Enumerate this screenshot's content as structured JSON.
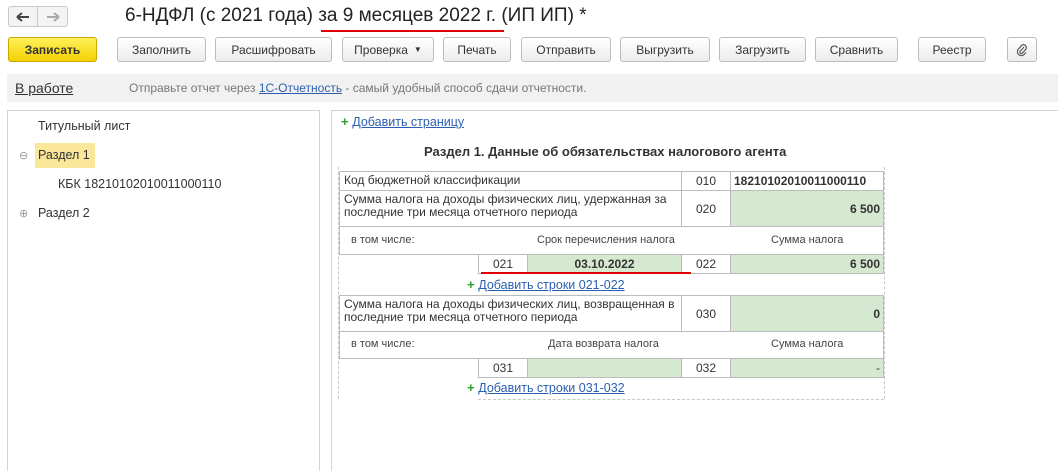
{
  "window": {
    "title_prefix": "6-НДФЛ (с 2021 года) ",
    "title_period": "за 9 месяцев 2022 г.",
    "title_suffix": " (ИП ИП) *",
    "back_icon": "arrow-left-icon",
    "forward_icon": "arrow-right-icon"
  },
  "toolbar": {
    "save": "Записать",
    "fill": "Заполнить",
    "decode": "Расшифровать",
    "check": "Проверка",
    "print": "Печать",
    "send": "Отправить",
    "export": "Выгрузить",
    "import": "Загрузить",
    "compare": "Сравнить",
    "registry": "Реестр",
    "attach_icon": "paperclip-icon"
  },
  "status": {
    "state": "В работе",
    "msg_before": "Отправьте отчет через ",
    "msg_link": "1С-Отчетность",
    "msg_after": " - самый удобный способ сдачи отчетности."
  },
  "tree": {
    "title_page": "Титульный лист",
    "section1": "Раздел 1",
    "kbk_item": "КБК 18210102010011000110",
    "section2": "Раздел 2"
  },
  "form": {
    "add_page": "Добавить страницу",
    "section_title": "Раздел 1. Данные об обязательствах налогового агента",
    "row010_label": "Код бюджетной классификации",
    "row010_code": "010",
    "row010_value": "18210102010011000110",
    "row020_label": "Сумма налога на доходы физических лиц, удержанная за последние три месяца отчетного периода",
    "row020_code": "020",
    "row020_value": "6 500",
    "including": "в том числе:",
    "transfer_deadline_header": "Срок перечисления налога",
    "tax_amount_header": "Сумма налога",
    "row021_code": "021",
    "row021_value": "03.10.2022",
    "row022_code": "022",
    "row022_value": "6 500",
    "add_rows_021_022": "Добавить строки 021-022",
    "row030_label": "Сумма налога на доходы физических лиц, возвращенная в последние три месяца отчетного периода",
    "row030_code": "030",
    "row030_value": "0",
    "including2": "в том числе:",
    "return_date_header": "Дата возврата налога",
    "tax_amount_header2": "Сумма налога",
    "row031_code": "031",
    "row031_value": "",
    "row032_code": "032",
    "row032_value": "-",
    "add_rows_031_032": "Добавить строки 031-032"
  },
  "colors": {
    "primary_button": "#f3d000",
    "field_green": "#d5e8d0",
    "link": "#2a5fb0",
    "highlight_underline": "#e00000",
    "tree_selection": "#fbe79a"
  }
}
